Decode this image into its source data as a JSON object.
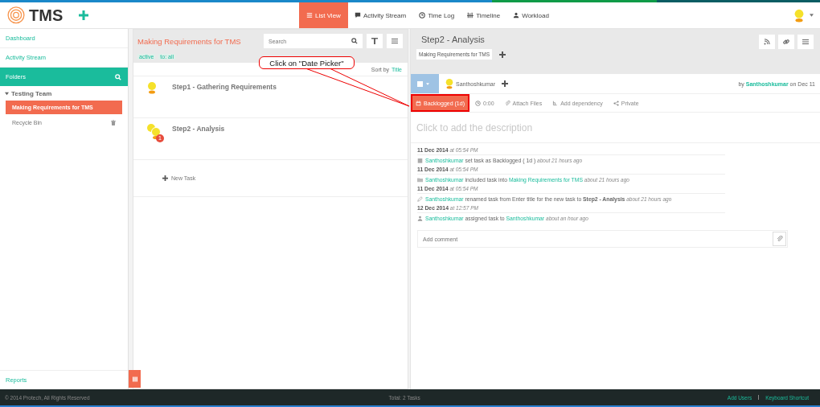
{
  "header": {
    "logo": "TMS",
    "nav": [
      {
        "label": "List View",
        "selected": true
      },
      {
        "label": "Activity Stream",
        "selected": false
      },
      {
        "label": "Time Log",
        "selected": false
      },
      {
        "label": "Timeline",
        "selected": false
      },
      {
        "label": "Workload",
        "selected": false
      }
    ]
  },
  "sidebar": {
    "links": [
      "Dashboard",
      "Activity Stream"
    ],
    "folders_title": "Folders",
    "tree": [
      {
        "label": "Testing Team",
        "expanded": true,
        "children": [
          {
            "label": "Making Requirements for TMS",
            "selected": true,
            "kind": "folder"
          },
          {
            "label": "Recycle Bin",
            "selected": false,
            "kind": "trash"
          }
        ]
      }
    ],
    "footer_link": "Reports"
  },
  "task_list": {
    "title": "Making Requirements for TMS",
    "search": {
      "placeholder": "Search"
    },
    "filters": [
      "active",
      "to: all"
    ],
    "sort_label": "Sort by",
    "sort_value": "Title",
    "tasks": [
      {
        "title": "Step1 - Gathering Requirements",
        "kind": "single"
      },
      {
        "title": "Step2 - Analysis",
        "kind": "group",
        "badge": "1"
      }
    ],
    "new_task": "New Task"
  },
  "task_detail": {
    "title": "Step2 - Analysis",
    "tags": [
      "Making Requirements for TMS"
    ],
    "checked": false,
    "assignee": "Santhoshkumar",
    "by": "by",
    "author": "Santhoshkumar",
    "date": "on Dec 11",
    "toolbar": [
      {
        "label": "Backlogged (1d)",
        "kind": "status",
        "highlighted": true
      },
      {
        "label": "0:00",
        "kind": "action",
        "highlighted": false
      },
      {
        "label": "Attach Files",
        "kind": "action",
        "highlighted": false
      },
      {
        "label": "Add dependency",
        "kind": "action",
        "highlighted": false
      },
      {
        "label": "Private",
        "kind": "action",
        "highlighted": false
      }
    ],
    "description": {
      "placeholder": "Click to add the description"
    },
    "activity": [
      {
        "date": "11 Dec 2014",
        "time": "at 05:54 PM",
        "parts": [
          {
            "kind": "link",
            "text": "Santhoshkumar"
          },
          {
            "kind": "plain",
            "text": "set task as Backlogged ( 1d )"
          }
        ],
        "ago": "about 21 hours ago"
      },
      {
        "date": "11 Dec 2014",
        "time": "at 05:54 PM",
        "parts": [
          {
            "kind": "link",
            "text": "Santhoshkumar"
          },
          {
            "kind": "plain",
            "text": "included task into"
          },
          {
            "kind": "link",
            "text": "Making Requirements for TMS"
          }
        ],
        "ago": "about 21 hours ago"
      },
      {
        "date": "11 Dec 2014",
        "time": "at 05:54 PM",
        "parts": [
          {
            "kind": "link",
            "text": "Santhoshkumar"
          },
          {
            "kind": "plain",
            "text": "renamed task from Enter title for the new task to"
          },
          {
            "kind": "bold",
            "text": "Step2 - Analysis"
          }
        ],
        "ago": "about 21 hours ago"
      },
      {
        "date": "12 Dec 2014",
        "time": "at 12:57 PM",
        "parts": [
          {
            "kind": "link",
            "text": "Santhoshkumar"
          },
          {
            "kind": "plain",
            "text": "assigned task to"
          },
          {
            "kind": "link",
            "text": "Santhoshkumar"
          }
        ],
        "ago": "about an hour ago"
      }
    ],
    "comment": {
      "placeholder": "Add comment"
    }
  },
  "annotation": {
    "text": "Click on \"Date Picker\""
  },
  "footer": {
    "copyright": "© 2014 Protech, All Rights Reserved",
    "total": "Total: 2 Tasks",
    "links": [
      "Add Users",
      "Keyboard Shortcut"
    ]
  }
}
